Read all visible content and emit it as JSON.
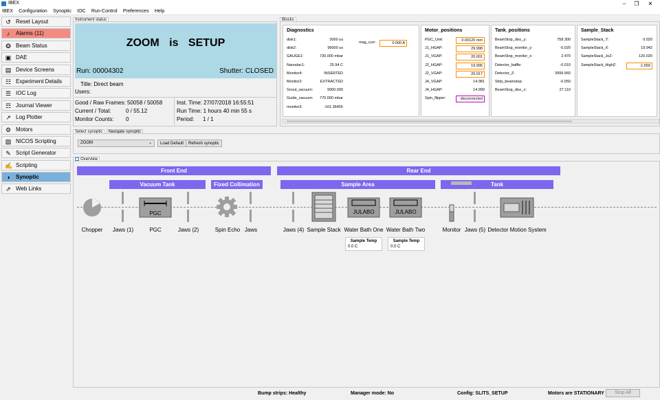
{
  "window": {
    "title": "IBEX"
  },
  "menu": [
    "IBEX",
    "Configuration",
    "Synoptic",
    "IOC",
    "Run-Control",
    "Preferences",
    "Help"
  ],
  "sidebar": [
    {
      "label": "Reset Layout",
      "icon": "reset-icon",
      "name": "sidebar-reset-layout"
    },
    {
      "label": "Alarms (11)",
      "icon": "bell-icon",
      "name": "sidebar-alarms"
    },
    {
      "label": "Beam Status",
      "icon": "beam-icon",
      "name": "sidebar-beam-status"
    },
    {
      "label": "DAE",
      "icon": "dae-icon",
      "name": "sidebar-dae"
    },
    {
      "label": "Device Screens",
      "icon": "device-icon",
      "name": "sidebar-device-screens"
    },
    {
      "label": "Experiment Details",
      "icon": "experiment-icon",
      "name": "sidebar-experiment-details"
    },
    {
      "label": "IOC Log",
      "icon": "log-icon",
      "name": "sidebar-ioc-log"
    },
    {
      "label": "Journal Viewer",
      "icon": "journal-icon",
      "name": "sidebar-journal-viewer"
    },
    {
      "label": "Log Plotter",
      "icon": "plot-icon",
      "name": "sidebar-log-plotter"
    },
    {
      "label": "Motors",
      "icon": "motors-icon",
      "name": "sidebar-motors"
    },
    {
      "label": "NICOS Scripting",
      "icon": "nicos-icon",
      "name": "sidebar-nicos-scripting"
    },
    {
      "label": "Script Generator",
      "icon": "script-generator-icon",
      "name": "sidebar-script-generator"
    },
    {
      "label": "Scripting",
      "icon": "scripting-icon",
      "name": "sidebar-scripting"
    },
    {
      "label": "Synoptic",
      "icon": "synoptic-icon",
      "name": "sidebar-synoptic"
    },
    {
      "label": "Web Links",
      "icon": "weblinks-icon",
      "name": "sidebar-web-links"
    }
  ],
  "instrument": {
    "tab": "Instrument status",
    "title": "ZOOM is SETUP",
    "run": "Run: 00004302",
    "shutter": "Shutter: CLOSED",
    "title_line": "Title: Direct beam",
    "users_line": "Users:",
    "frames": "Good / Raw Frames: 50058 / 50058",
    "current": "Current / Total:",
    "current_val": "0 / 55.12",
    "monitor": "Monitor Counts:",
    "monitor_val": "0",
    "inst_time": "Inst. Time: 27/07/2018 16:55:51",
    "run_time": "Run Time: 1 hours 40 min 55 s",
    "period": "Period:",
    "period_val": "1 / 1"
  },
  "blocks": {
    "tab": "Blocks",
    "groups": {
      "diagnostics": {
        "title": "Diagnostics",
        "rows": [
          [
            "disk1:",
            "3000 us"
          ],
          [
            "disk2:",
            "99000 us"
          ],
          [
            "GAUGE1:",
            "730.000 mbar"
          ],
          [
            "Nanodac1:",
            "25.94 C"
          ],
          [
            "Monitor4:",
            "INSERTED"
          ],
          [
            "Monitor2:",
            "EXTRACTED"
          ],
          [
            "Snout_vacuum:",
            "9900.000"
          ],
          [
            "Guide_vacuum:",
            "770.000 mbar"
          ],
          [
            "monitor3:",
            "-161.36455"
          ]
        ],
        "mag_name": "mag_curr:",
        "mag_val": "0.000 A"
      },
      "motor_positions": {
        "title": "Motor_positions",
        "rows": [
          [
            "PGC_Unit:",
            "0.00120 mm"
          ],
          [
            "J1_HGAP:",
            "29.998"
          ],
          [
            "J1_VGAP:",
            "20.001"
          ],
          [
            "J2_HGAP:",
            "19.995"
          ],
          [
            "J2_VGAP:",
            "20.017"
          ],
          [
            "J4_VGAP:",
            "14.981"
          ],
          [
            "J4_HGAP:",
            "14.999"
          ],
          [
            "Spin_flipper:",
            "disconnected"
          ]
        ]
      },
      "tank_positions": {
        "title": "Tank_positions",
        "rows": [
          [
            "BeamStop_disc_y:",
            "758.300"
          ],
          [
            "BeamStop_monitor_y:",
            "-0.020"
          ],
          [
            "BeamStop_monitor_x:",
            "2.470"
          ],
          [
            "Detector_baffle:",
            "-0.010"
          ],
          [
            "Detector_Z:",
            "3999.960"
          ],
          [
            "Strip_beamstop:",
            "-0.050"
          ],
          [
            "BeamStop_disc_x:",
            "27.110"
          ]
        ]
      },
      "sample_stack": {
        "title": "Sample_Stack",
        "rows": [
          [
            "SampleStack_Y:",
            "0.020"
          ],
          [
            "SampleStack_X:",
            "19.942"
          ],
          [
            "SampleStack_JoZ:",
            "120.020"
          ],
          [
            "SampleStack_HighZ:",
            "-1.659"
          ]
        ]
      }
    }
  },
  "synoptic_select": {
    "tabs": [
      "Select synoptic",
      "Navigate synoptic"
    ],
    "selected": "ZOOM",
    "load_default": "Load Default",
    "refresh": "Refresh synoptic"
  },
  "overview": {
    "tab": "Overview",
    "sections": [
      "Front End",
      "Rear End"
    ],
    "subsections": [
      "Vacuum Tank",
      "Fixed Collimation",
      "Sample Area",
      "Tank"
    ],
    "components": [
      "Chopper",
      "Jaws (1)",
      "PGC",
      "Jaws (2)",
      "Spin Echo",
      "Jaws",
      "Jaws (4)",
      "Sample Stack",
      "Water Bath One",
      "Water Bath Two",
      "Monitor",
      "Jaws (5)",
      "Detector Motion System"
    ],
    "icon_labels": {
      "pgc": "PGC",
      "julabo": "JULABO"
    },
    "water_bath_one": {
      "label": "Sample Temp",
      "value": "0.0 C"
    },
    "water_bath_two": {
      "label": "Sample Temp",
      "value": "0.0 C"
    }
  },
  "status": {
    "bump": "Bump strips: Healthy",
    "manager": "Manager mode: No",
    "config": "Config: SLITS_SETUP",
    "motors": "Motors are STATIONARY",
    "stop_all": "Stop All"
  },
  "colors": {
    "alarm": "#f28b82",
    "active": "#7ab0dc",
    "bar": "#7b68ee",
    "status_bg": "#add8e6",
    "block_border": "#ff8c00",
    "disconnected_border": "#c000c0"
  }
}
